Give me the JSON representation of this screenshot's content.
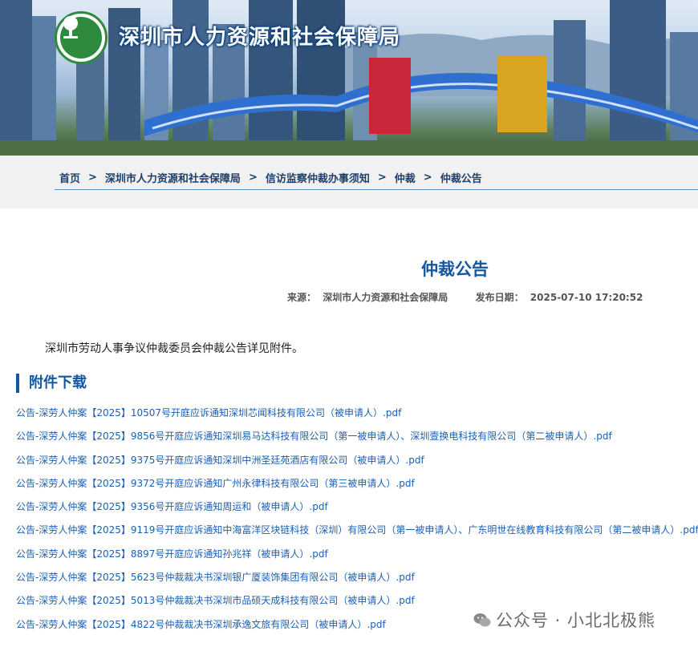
{
  "site": {
    "title": "深圳市人力资源和社会保障局",
    "logo_icon": "tree-emblem-icon"
  },
  "breadcrumb": {
    "items": [
      {
        "label": "首页"
      },
      {
        "label": "深圳市人力资源和社会保障局"
      },
      {
        "label": "信访监察仲裁办事须知"
      },
      {
        "label": "仲裁"
      },
      {
        "label": "仲裁公告"
      }
    ],
    "separator": ">"
  },
  "article": {
    "title": "仲裁公告",
    "source_label": "来源：",
    "source_value": "深圳市人力资源和社会保障局",
    "date_label": "发布日期：",
    "date_value": "2025-07-10 17:20:52",
    "intro": "深圳市劳动人事争议仲裁委员会仲裁公告详见附件。"
  },
  "attachments": {
    "heading": "附件下载",
    "items": [
      {
        "label": "公告-深劳人仲案【2025】10507号开庭应诉通知深圳芯闻科技有限公司（被申请人）.pdf"
      },
      {
        "label": "公告-深劳人仲案【2025】9856号开庭应诉通知深圳易马达科技有限公司（第一被申请人）、深圳壹换电科技有限公司（第二被申请人）.pdf"
      },
      {
        "label": "公告-深劳人仲案【2025】9375号开庭应诉通知深圳中洲圣廷苑酒店有限公司（被申请人）.pdf"
      },
      {
        "label": "公告-深劳人仲案【2025】9372号开庭应诉通知广州永律科技有限公司（第三被申请人）.pdf"
      },
      {
        "label": "公告-深劳人仲案【2025】9356号开庭应诉通知周运和（被申请人）.pdf"
      },
      {
        "label": "公告-深劳人仲案【2025】9119号开庭应诉通知中海富洋区块链科技（深圳）有限公司（第一被申请人）、广东明世在线教育科技有限公司（第二被申请人）.pdf"
      },
      {
        "label": "公告-深劳人仲案【2025】8897号开庭应诉通知孙兆祥（被申请人）.pdf"
      },
      {
        "label": "公告-深劳人仲案【2025】5623号仲裁裁决书深圳银广厦装饰集团有限公司（被申请人）.pdf"
      },
      {
        "label": "公告-深劳人仲案【2025】5013号仲裁裁决书深圳市品硕天成科技有限公司（被申请人）.pdf"
      },
      {
        "label": "公告-深劳人仲案【2025】4822号仲裁裁决书深圳承逸文旅有限公司（被申请人）.pdf"
      }
    ]
  },
  "watermark": {
    "text": "公众号 · 小北北极熊",
    "icon": "wechat-icon"
  },
  "colors": {
    "accent": "#14579f",
    "link": "#1a5fb4",
    "logo_green": "#2e8b3e"
  }
}
